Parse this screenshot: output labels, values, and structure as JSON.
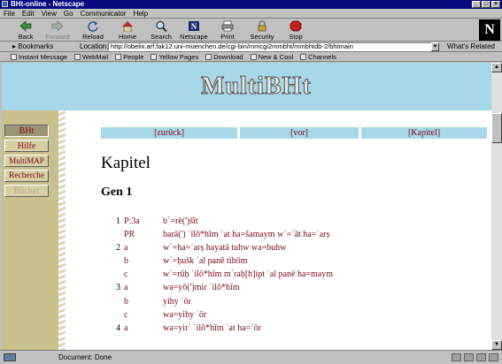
{
  "window": {
    "title": "BHt-online - Netscape"
  },
  "menu": [
    "File",
    "Edit",
    "View",
    "Go",
    "Communicator",
    "Help"
  ],
  "toolbar": [
    {
      "label": "Back",
      "icon": "back-arrow-icon",
      "enabled": true
    },
    {
      "label": "Forward",
      "icon": "forward-arrow-icon",
      "enabled": false
    },
    {
      "label": "Reload",
      "icon": "reload-icon",
      "enabled": true
    },
    {
      "label": "Home",
      "icon": "home-icon",
      "enabled": true
    },
    {
      "label": "Search",
      "icon": "search-icon",
      "enabled": true
    },
    {
      "label": "Netscape",
      "icon": "netscape-icon",
      "enabled": true
    },
    {
      "label": "Print",
      "icon": "print-icon",
      "enabled": true
    },
    {
      "label": "Security",
      "icon": "lock-icon",
      "enabled": true
    },
    {
      "label": "Stop",
      "icon": "stop-icon",
      "enabled": true
    }
  ],
  "location": {
    "bookmarks_label": "Bookmarks",
    "label": "Location:",
    "url": "http://obelix.arf.fak12.uni-muenchen.de/cgi-bin/mmcgi2mmbht/mmbhtdb-2/bhtmain",
    "related_label": "What's Related"
  },
  "personal_toolbar": [
    "Instant Message",
    "WebMail",
    "People",
    "Yellow Pages",
    "Download",
    "New & Cool",
    "Channels"
  ],
  "page": {
    "logo_text": "MultiBHt",
    "sidebar": [
      {
        "label": "BHt",
        "state": "active"
      },
      {
        "label": "Hilfe",
        "state": "normal"
      },
      {
        "label": "MultiMAP",
        "state": "normal"
      },
      {
        "label": "Recherche",
        "state": "normal"
      },
      {
        "label": "Bücher",
        "state": "disabled"
      }
    ],
    "nav": [
      {
        "label": "[zurück]"
      },
      {
        "label": "[vor]"
      },
      {
        "label": "[Kapitel]"
      }
    ],
    "heading": "Kapitel",
    "subheading": "Gen 1",
    "verses": [
      {
        "num": "1",
        "label": "P:3a",
        "text": "b´=rē(')šīt"
      },
      {
        "num": "",
        "label": "PR",
        "text": "barā(') ʾilō*hīm ʾat ha=šamaym w´=ʾāt ha=ʾarṣ"
      },
      {
        "num": "2",
        "label": "a",
        "text": "w´=ha=ʾarṣ hayatā tuhw wa=buhw"
      },
      {
        "num": "",
        "label": "b",
        "text": "w´=ḥušk ʿal panē tihōm"
      },
      {
        "num": "",
        "label": "c",
        "text": "w´=rūḥ ʾilō*hīm m´raḥ[h]ipt ʿal panē ha=maym"
      },
      {
        "num": "3",
        "label": "a",
        "text": "wa=yō(')mir ʾilō*hīm"
      },
      {
        "num": "",
        "label": "b",
        "text": "yihy ʾōr"
      },
      {
        "num": "",
        "label": "c",
        "text": "wa=yihy ʾōr"
      },
      {
        "num": "4",
        "label": "a",
        "text": "wa=yirʾ ʾilō*hīm ʾat ha=ʾōr"
      }
    ]
  },
  "status": {
    "text": "Document: Done"
  },
  "colors": {
    "link": "#7a0a1a",
    "banner": "#a8d8e8",
    "sidebar": "#c9c08e",
    "titlebar": "#0a0a80"
  }
}
